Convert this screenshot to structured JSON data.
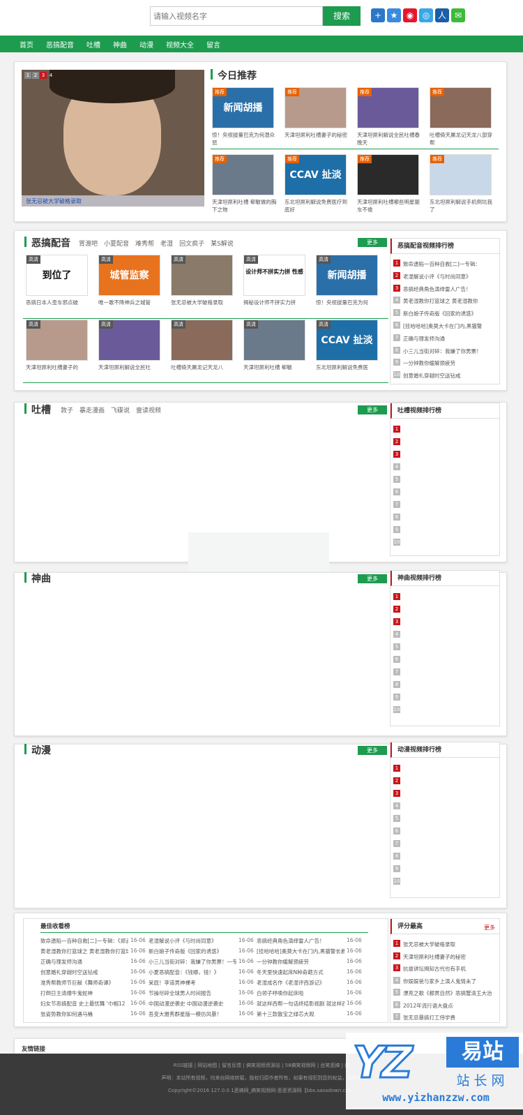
{
  "search": {
    "placeholder": "请输入视频名字",
    "button": "搜索"
  },
  "share_icons": [
    {
      "name": "plus-share-icon",
      "glyph": "+",
      "color": "#2b78c8"
    },
    {
      "name": "qzone-icon",
      "glyph": "★",
      "color": "#3a8be0"
    },
    {
      "name": "weibo-icon",
      "glyph": "◉",
      "color": "#e6162d"
    },
    {
      "name": "tencent-weibo-icon",
      "glyph": "◎",
      "color": "#3aa6e5"
    },
    {
      "name": "renren-icon",
      "glyph": "人",
      "color": "#1a5ea8"
    },
    {
      "name": "wechat-icon",
      "glyph": "✉",
      "color": "#3dba3a"
    }
  ],
  "nav": [
    "首页",
    "恶搞配音",
    "吐槽",
    "神曲",
    "动漫",
    "视频大全",
    "留言"
  ],
  "today": {
    "title": "今日推荐",
    "slider_pages": [
      "1",
      "2",
      "3",
      "4"
    ],
    "slider_caption": "张无忌被大学破格录取",
    "badge": "推荐",
    "items": [
      {
        "caption": "惊！央视拔量巴克为何潜众怒",
        "thumb": "新闻胡播",
        "bg": "#2a6fa8"
      },
      {
        "caption": "天津坦屌利吐槽妻子的秘密",
        "thumb": "",
        "bg": "#b89a8c"
      },
      {
        "caption": "天津坦屌利解说全民吐槽春晚天",
        "thumb": "",
        "bg": "#6a5a9a"
      },
      {
        "caption": "吐槽倚天屠龙记天龙八部穿帮",
        "thumb": "",
        "bg": "#8a6a5a"
      },
      {
        "caption": "天津坦屌利吐槽 郗敏做的胸下之物",
        "thumb": "",
        "bg": "#6a7a8a"
      },
      {
        "caption": "东北坦屌利解说免费医疗到底好",
        "thumb": "CCAV 扯淡",
        "bg": "#1e6fa8"
      },
      {
        "caption": "天津坦屌利吐槽哪些明星躯车不倦",
        "thumb": "",
        "bg": "#2a2a2a"
      },
      {
        "caption": "东北坦屌利解说手机倒坑我了",
        "thumb": "",
        "bg": "#c8d8e8"
      }
    ]
  },
  "egao": {
    "title": "恶搞配音",
    "tabs": [
      "胃渡吧",
      "小夏配音",
      "难秀帮",
      "老湿",
      "回文疯子",
      "某S解说"
    ],
    "more": "更多",
    "badge": "高清",
    "items": [
      {
        "caption": "恶搞日本人歪车邪点破",
        "thumb": "到位了",
        "bg": "#ffffff"
      },
      {
        "caption": "唯一敢不降神兵之城管",
        "thumb": "城管监察",
        "bg": "#e8731e"
      },
      {
        "caption": "张无忌被大学破格录取",
        "thumb": "",
        "bg": "#8a7a6a"
      },
      {
        "caption": "揭秘设计师不拼实力拼",
        "thumb": "设计师不拼实力拼 性感",
        "bg": "#ffffff"
      },
      {
        "caption": "惊！央视拔量巴克为何",
        "thumb": "新闻胡播",
        "bg": "#2a6fa8"
      },
      {
        "caption": "天津坦屌利吐槽妻子的",
        "thumb": "",
        "bg": "#b89a8c"
      },
      {
        "caption": "天津坦屌利解说全民吐",
        "thumb": "",
        "bg": "#6a5a9a"
      },
      {
        "caption": "吐槽倚天屠龙记天龙八",
        "thumb": "",
        "bg": "#8a6a5a"
      },
      {
        "caption": "天津坦屌利吐槽 郗敏",
        "thumb": "",
        "bg": "#6a7a8a"
      },
      {
        "caption": "东北坦屌利解说免费医",
        "thumb": "CCAV 扯淡",
        "bg": "#1e6fa8"
      }
    ],
    "rank_title": "恶搞配音视频排行榜",
    "rank": [
      "致命遗陷一百种自救[二]一专辑：",
      "老湿解说小评《与时尚同意》",
      "恶搞经典角色演绎雷人广告！",
      "黄老湿教你打篮球之 黄老湿教你",
      "新白娘子传奇版《回家的诱惑》",
      "[挂哈哈哈]奥莫大卡在门内,黑猫警",
      "正确与理发师沟通",
      "小三儿当街对碎：我嫌了你男票！",
      "一分钟教你缓解颈疲劳",
      "创意婚礼穿越时空送钻戒"
    ]
  },
  "tucao": {
    "title": "吐槽",
    "tabs": [
      "敦子",
      "暴走漫画",
      "飞碟说",
      "壹读视频"
    ],
    "more": "更多",
    "rank_title": "吐槽视频排行榜"
  },
  "shenqu": {
    "title": "神曲",
    "more": "更多",
    "rank_title": "神曲视频排行榜"
  },
  "dongman": {
    "title": "动漫",
    "more": "更多",
    "rank_title": "动漫视频排行榜"
  },
  "rank_numbers": [
    "1",
    "2",
    "3",
    "4",
    "5",
    "6",
    "7",
    "8",
    "9",
    "10"
  ],
  "best": {
    "title": "最佳收看榜",
    "date": "16-06",
    "col1": [
      "致命遗陷一百种自救[二]一专辑：《郑云",
      "黄老湿教你打篮球之 黄老湿教你打篮球之",
      "正确与理发师沟通",
      "创意婚礼穿越时空送钻戒",
      "淮秀帮教师节巨献《舞师奇谭》",
      "打倒日主清爆牛鬼蛇神",
      "妇女节恶搞配音 史上最忧舞 '巾帼12",
      "张姿势教你如何遇马桶"
    ],
    "col2": [
      "老湿解说小评《与时尚同意》",
      "新白娘子传奇版《回家的诱惑》",
      "小三儿当街对碎：我嫌了你男票！一专",
      "小夏恶搞配音：《钱哪，钱！》",
      "呆屁！李道男神裸考",
      "节操尽碎全球男人时间报告",
      "中国动漫逆袭史 中国动漫逆袭史",
      "吾变大雅秀群星版一模仿风暴！"
    ],
    "col3": [
      "恶搞经典角色演绎雷人广告！",
      "[挂哈哈哈]奥莫大卡在门内,黑猫警长救援",
      "一分钟教你缓解颈疲劳",
      "冬天里快速起床N种奇葩方式",
      "老湿成名作《老湿评西游记》",
      "白领子呼唤你起床啦",
      "就这样西帮一句话终结影视剧 就这样西",
      "第十三款散宝之绿芯大观"
    ]
  },
  "score": {
    "title": "评分最高",
    "more": "更多",
    "items": [
      "张无忌被大学破格录取",
      "天津坦屌利吐槽妻子的秘密",
      "抗拔讲坛揭知古代也有手机",
      "你娱娱爸与家乡上演人鬼情未了",
      "漂亮之歌《都贯自然》恶搞蟹清王大治",
      "2012年流行语大盘点",
      "张无忌暴搞打工侍学费"
    ]
  },
  "friends": {
    "title": "友情链接"
  },
  "footer": {
    "links": "RSS链接 | 网站地图 | 留言反馈 | 搞笑视频资源站 | 58搞笑视频网 | 丝笑恶搞 | 搞",
    "notice": "声明：本站所有视频，均来自网络转载，版权归原作者所有，如果有侵犯到您的权益，请联系",
    "copyright": "Copyright©2016 127.0.0.1恶搞网_搞笑视频网-恶恶资源网【bbs.sasadown.cn】.",
    "logo_letters": "YZ",
    "logo_cn": "易站",
    "logo_sub": "站长网",
    "logo_url": "www.yizhanzzw.com"
  }
}
